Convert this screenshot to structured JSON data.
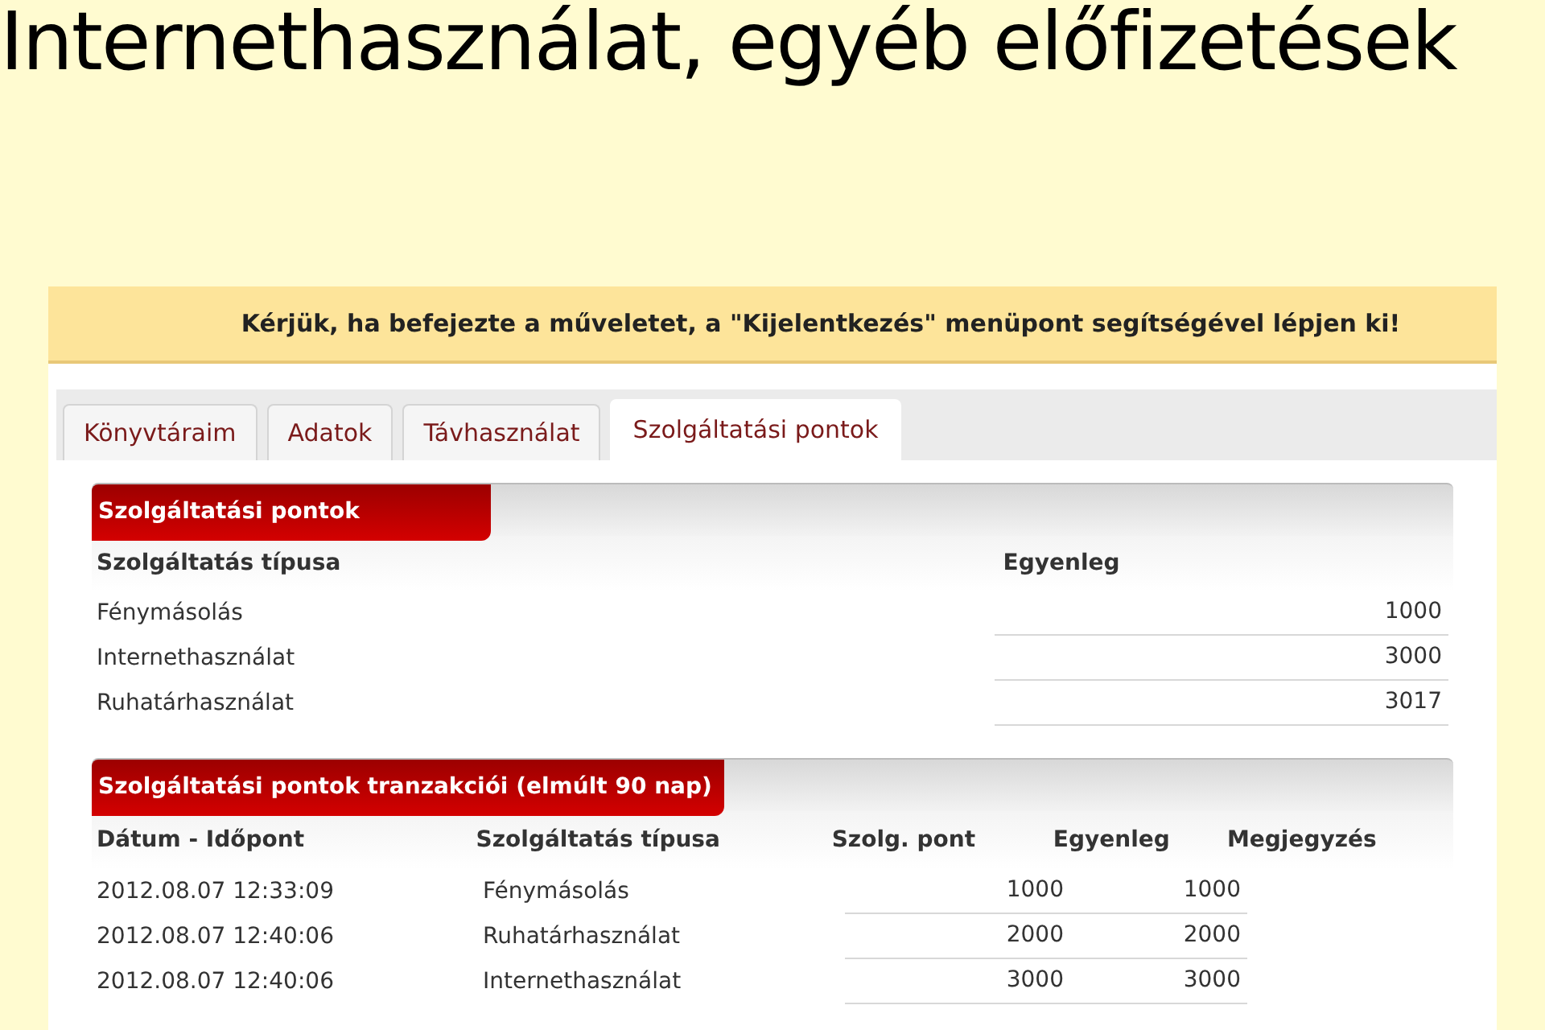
{
  "slide_title": "Internethasználat, egyéb előfizetések",
  "notice": "Kérjük, ha befejezte a műveletet, a \"Kijelentkezés\" menüpont segítségével lépjen ki!",
  "tabs": [
    {
      "label": "Könyvtáraim",
      "selected": false
    },
    {
      "label": "Adatok",
      "selected": false
    },
    {
      "label": "Távhasználat",
      "selected": false
    },
    {
      "label": "Szolgáltatási pontok",
      "selected": true
    }
  ],
  "balances": {
    "title": "Szolgáltatási pontok",
    "columns": [
      "Szolgáltatás típusa",
      "Egyenleg"
    ],
    "rows": [
      [
        "Fénymásolás",
        "1000"
      ],
      [
        "Internethasználat",
        "3000"
      ],
      [
        "Ruhatárhasználat",
        "3017"
      ]
    ]
  },
  "transactions": {
    "title": "Szolgáltatási pontok tranzakciói (elmúlt 90 nap)",
    "columns": [
      "Dátum - Időpont",
      "Szolgáltatás típusa",
      "Szolg. pont",
      "Egyenleg",
      "Megjegyzés"
    ],
    "rows": [
      [
        "2012.08.07 12:33:09",
        "Fénymásolás",
        "1000",
        "1000"
      ],
      [
        "2012.08.07 12:40:06",
        "Ruhatárhasználat",
        "2000",
        "2000"
      ],
      [
        "2012.08.07 12:40:06",
        "Internethasználat",
        "3000",
        "3000"
      ]
    ]
  }
}
